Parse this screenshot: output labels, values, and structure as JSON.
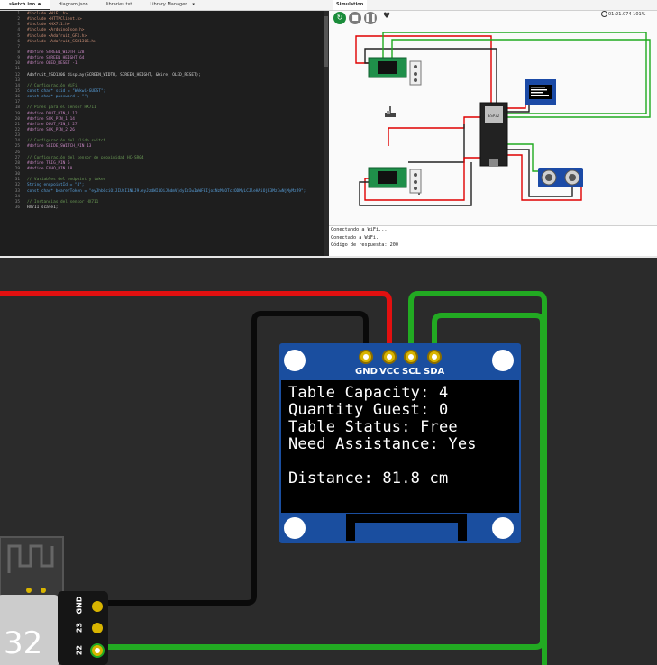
{
  "editor": {
    "tabs": [
      {
        "label": "sketch.ino",
        "modified": true
      },
      {
        "label": "diagram.json"
      },
      {
        "label": "libraries.txt"
      },
      {
        "label": "Library Manager",
        "dropdown": "▾"
      }
    ],
    "code_lines": [
      {
        "n": "1",
        "text": "#include <WiFi.h>"
      },
      {
        "n": "2",
        "text": "#include <HTTPClient.h>"
      },
      {
        "n": "3",
        "text": "#include <HX711.h>"
      },
      {
        "n": "4",
        "text": "#include <ArduinoJson.h>"
      },
      {
        "n": "5",
        "text": "#include <Adafruit_GFX.h>"
      },
      {
        "n": "6",
        "text": "#include <Adafruit_SSD1306.h>"
      },
      {
        "n": "7",
        "text": ""
      },
      {
        "n": "8",
        "text": "#define SCREEN_WIDTH 128"
      },
      {
        "n": "9",
        "text": "#define SCREEN_HEIGHT 64"
      },
      {
        "n": "10",
        "text": "#define OLED_RESET -1"
      },
      {
        "n": "11",
        "text": ""
      },
      {
        "n": "12",
        "text": "Adafruit_SSD1306 display(SCREEN_WIDTH, SCREEN_HEIGHT, &Wire, OLED_RESET);"
      },
      {
        "n": "13",
        "text": ""
      },
      {
        "n": "14",
        "text": "// Configuración WiFi"
      },
      {
        "n": "15",
        "text": "const char* ssid = \"Wokwi-GUEST\";"
      },
      {
        "n": "16",
        "text": "const char* password = \"\";"
      },
      {
        "n": "17",
        "text": ""
      },
      {
        "n": "18",
        "text": "// Pines para el sensor HX711"
      },
      {
        "n": "19",
        "text": "#define DOUT_PIN_1 12"
      },
      {
        "n": "20",
        "text": "#define SCK_PIN_1 14"
      },
      {
        "n": "21",
        "text": "#define DOUT_PIN_2 27"
      },
      {
        "n": "22",
        "text": "#define SCK_PIN_2 26"
      },
      {
        "n": "23",
        "text": ""
      },
      {
        "n": "24",
        "text": "// Configuración del slide switch"
      },
      {
        "n": "25",
        "text": "#define SLIDE_SWITCH_PIN 13"
      },
      {
        "n": "26",
        "text": ""
      },
      {
        "n": "27",
        "text": "// Configuración del sensor de proximidad HC-SR04"
      },
      {
        "n": "28",
        "text": "#define TRIG_PIN 5"
      },
      {
        "n": "29",
        "text": "#define ECHO_PIN 18"
      },
      {
        "n": "30",
        "text": ""
      },
      {
        "n": "31",
        "text": "// Variables del endpoint y token"
      },
      {
        "n": "32",
        "text": "String endpointId = \"4\";"
      },
      {
        "n": "33",
        "text": "const char* bearerToken = \"eyJhbGciOiJIUzI1NiJ9.eyJzdWIiOiJhdmVjdyIzIwIaWF0IjoxNzMxOTczODMyLCJleHAiOjE3MzIwNjMyMzJ9\";"
      },
      {
        "n": "34",
        "text": ""
      },
      {
        "n": "35",
        "text": "// Instancias del sensor HX711"
      },
      {
        "n": "36",
        "text": "HX711 scale1;"
      }
    ]
  },
  "simulation": {
    "tab_label": "Simulation",
    "controls": {
      "restart": "↻",
      "stop": "■",
      "pause": "❚❚",
      "favorite": "♥"
    },
    "timer": "01:21.074",
    "timer_extra": "101%",
    "serial_lines": [
      "Conectando a WiFi...",
      "Conectado a WiFi.",
      "Código de respuesta: 200"
    ],
    "hc_label": "HC-SR04",
    "esp_label": "ESP32"
  },
  "zoom": {
    "oled_pins": [
      "GND",
      "VCC",
      "SCL",
      "SDA"
    ],
    "esp_pins": [
      "GND",
      "23",
      "22"
    ],
    "esp_model_text": "32",
    "oled_lines": [
      "Table Capacity: 4",
      "Quantity Guest: 0",
      "Table Status: Free",
      "Need Assistance: Yes",
      "",
      "Distance: 81.8 cm"
    ],
    "wire_colors": {
      "vcc": "#e00000",
      "gnd": "#000000",
      "scl": "#1faa1f",
      "sda": "#1faa1f"
    }
  }
}
